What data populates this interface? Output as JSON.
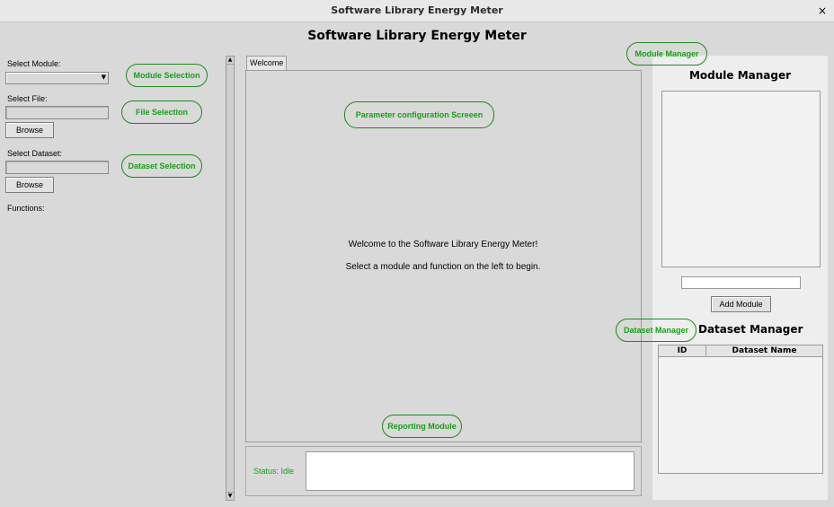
{
  "window": {
    "title": "Software Library Energy Meter",
    "close_glyph": "×"
  },
  "app_title": "Software Library Energy Meter",
  "left": {
    "select_module_label": "Select Module:",
    "select_file_label": "Select File:",
    "browse_label": "Browse",
    "select_dataset_label": "Select Dataset:",
    "functions_label": "Functions:"
  },
  "notebook": {
    "tabs": [
      {
        "label": "Welcome"
      }
    ]
  },
  "welcome": {
    "line1": "Welcome to the Software Library Energy Meter!",
    "line2": "Select a module and function on the left to begin."
  },
  "status": {
    "text": "Status: Idle"
  },
  "module_manager": {
    "title": "Module Manager",
    "add_label": "Add Module"
  },
  "dataset_manager": {
    "title": "Dataset Manager",
    "columns": [
      "ID",
      "Dataset Name"
    ]
  },
  "annotations": {
    "module_selection": "Module Selection",
    "file_selection": "File Selection",
    "dataset_selection": "Dataset Selection",
    "parameter_config": "Parameter configuration Screeen",
    "module_manager": "Module Manager",
    "dataset_manager": "Dataset Manager",
    "reporting_module": "Reporting Module"
  },
  "colors": {
    "annotation": "#15a015",
    "annotation_border": "#1e8a1e",
    "background": "#d9d9d9"
  }
}
